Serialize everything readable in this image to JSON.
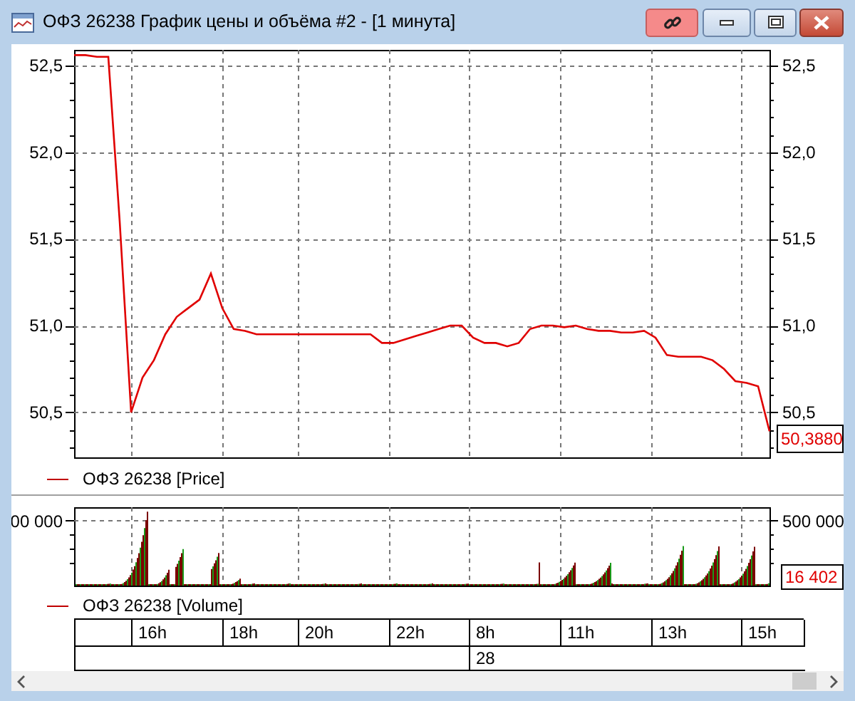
{
  "window": {
    "title": "ОФЗ 26238 График цены и объёма #2 - [1 минута]"
  },
  "price_panel": {
    "right_axis_labels": [
      "52,5",
      "52,0",
      "51,5",
      "51,0",
      "50,5"
    ],
    "last_value": "50,3880",
    "chart_data": {
      "type": "line",
      "grid": true,
      "ylim": [
        50.24,
        52.59
      ],
      "yticks": [
        {
          "value": 52.5,
          "label": "52,5"
        },
        {
          "value": 52.0,
          "label": "52,0"
        },
        {
          "value": 51.5,
          "label": "51,5"
        },
        {
          "value": 51.0,
          "label": "51,0"
        },
        {
          "value": 50.5,
          "label": "50,5"
        }
      ],
      "series": [
        {
          "name": "ОФЗ 26238 [Price]",
          "color": "#e00000",
          "values": [
            52.56,
            52.56,
            52.55,
            52.55,
            51.6,
            50.5,
            50.7,
            50.8,
            50.95,
            51.05,
            51.1,
            51.15,
            51.3,
            51.1,
            50.98,
            50.97,
            50.95,
            50.95,
            50.95,
            50.95,
            50.95,
            50.95,
            50.95,
            50.95,
            50.95,
            50.95,
            50.95,
            50.9,
            50.9,
            50.92,
            50.94,
            50.96,
            50.98,
            51.0,
            51.0,
            50.93,
            50.9,
            50.9,
            50.88,
            50.9,
            50.98,
            51.0,
            51.0,
            50.99,
            51.0,
            50.98,
            50.97,
            50.97,
            50.96,
            50.96,
            50.97,
            50.93,
            50.83,
            50.82,
            50.82,
            50.82,
            50.8,
            50.75,
            50.68,
            50.67,
            50.65,
            50.39
          ]
        }
      ]
    }
  },
  "volume_panel": {
    "left_label": "00 000",
    "right_label": "500 000",
    "last_value": "16 402",
    "legend": "ОФЗ 26238 [Volume]"
  },
  "time_axis": {
    "hours": [
      "16h",
      "18h",
      "20h",
      "22h",
      "8h",
      "11h",
      "13h",
      "15h"
    ],
    "dates": [
      "28"
    ]
  }
}
